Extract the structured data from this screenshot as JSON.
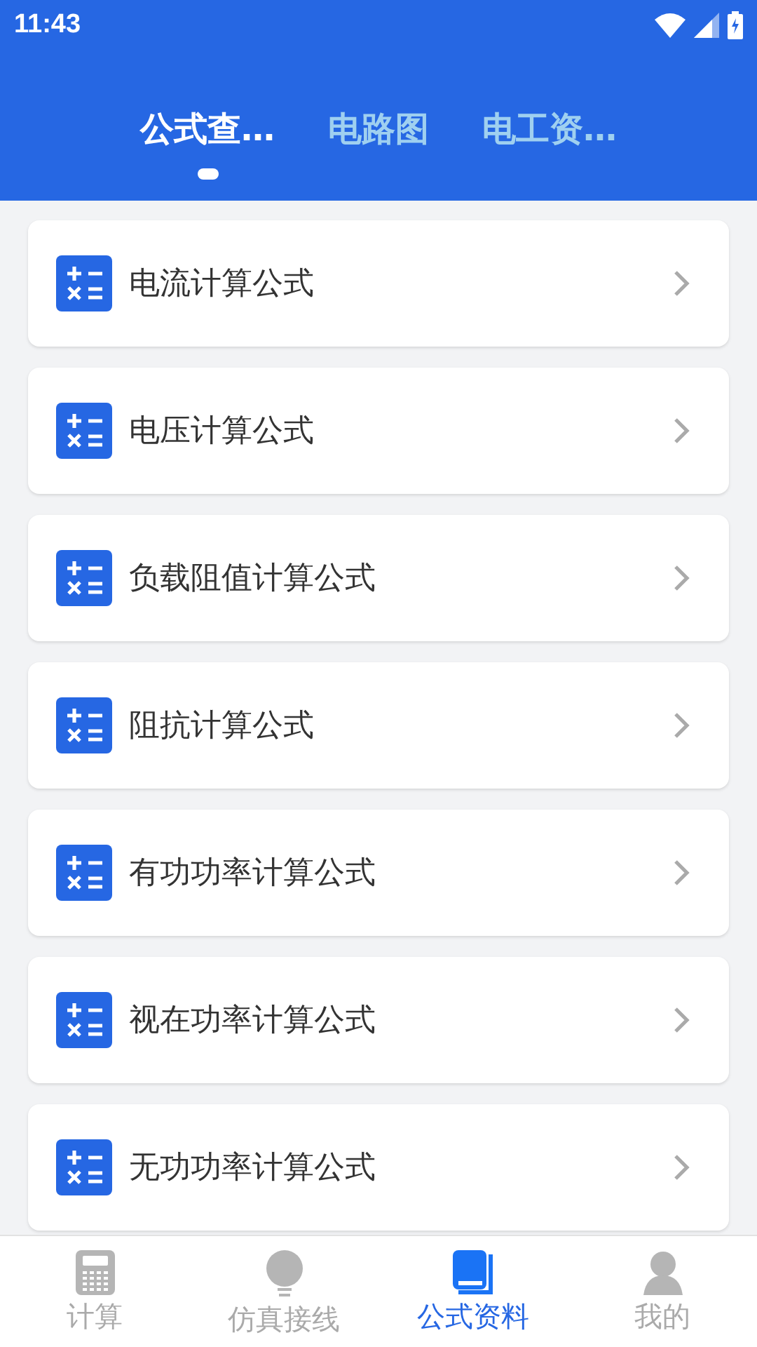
{
  "status_bar": {
    "time": "11:43"
  },
  "tabs": [
    {
      "label": "公式查…",
      "selected": true
    },
    {
      "label": "电路图",
      "selected": false
    },
    {
      "label": "电工资…",
      "selected": false
    }
  ],
  "items": [
    {
      "label": "电流计算公式"
    },
    {
      "label": "电压计算公式"
    },
    {
      "label": "负载阻值计算公式"
    },
    {
      "label": "阻抗计算公式"
    },
    {
      "label": "有功功率计算公式"
    },
    {
      "label": "视在功率计算公式"
    },
    {
      "label": "无功功率计算公式"
    }
  ],
  "bottom_nav": [
    {
      "kind": "calculator",
      "label": "计算",
      "selected": false
    },
    {
      "kind": "bulb",
      "label": "仿真接线",
      "selected": false
    },
    {
      "kind": "book",
      "label": "公式资料",
      "selected": true
    },
    {
      "kind": "person",
      "label": "我的",
      "selected": false
    }
  ]
}
